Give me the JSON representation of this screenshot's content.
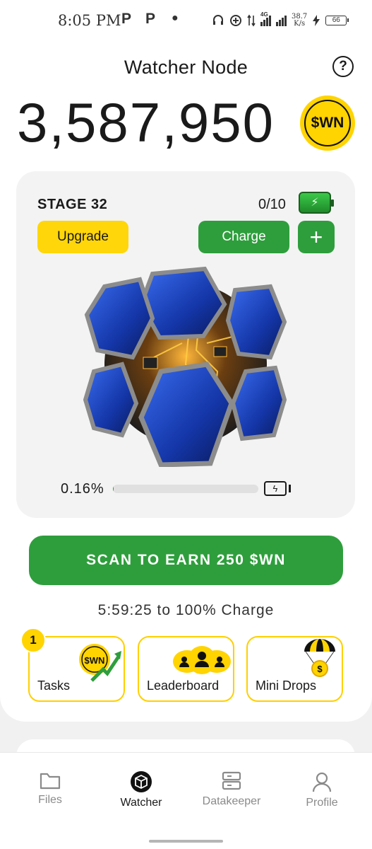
{
  "status_bar": {
    "time": "8:05 PM",
    "app_icon_1": "P",
    "app_icon_2": "P",
    "net_speed_value": "38.7",
    "net_speed_unit": "K/s",
    "network_type": "4G",
    "battery": "66"
  },
  "header": {
    "title": "Watcher Node",
    "help_icon": "?"
  },
  "balance": {
    "amount": "3,587,950",
    "token_badge": "$WN"
  },
  "node": {
    "stage_label": "STAGE 32",
    "charges": "0/10",
    "upgrade_label": "Upgrade",
    "charge_label": "Charge",
    "plus_label": "+",
    "progress_text": "0.16%",
    "progress_fraction": 0.0016
  },
  "scan_button_label": "SCAN TO EARN 250 $WN",
  "charge_timer": "5:59:25 to 100% Charge",
  "tiles": {
    "tasks": {
      "label": "Tasks",
      "badge": "1",
      "icon_text": "$WN"
    },
    "leaderboard": {
      "label": "Leaderboard"
    },
    "mini_drops": {
      "label": "Mini Drops",
      "icon_text": "$"
    }
  },
  "bottom_nav": {
    "files": "Files",
    "watcher": "Watcher",
    "datakeeper": "Datakeeper",
    "profile": "Profile"
  },
  "colors": {
    "accent_green": "#2e9e3c",
    "accent_yellow": "#ffd60a",
    "tile_border": "#ffcf00"
  }
}
